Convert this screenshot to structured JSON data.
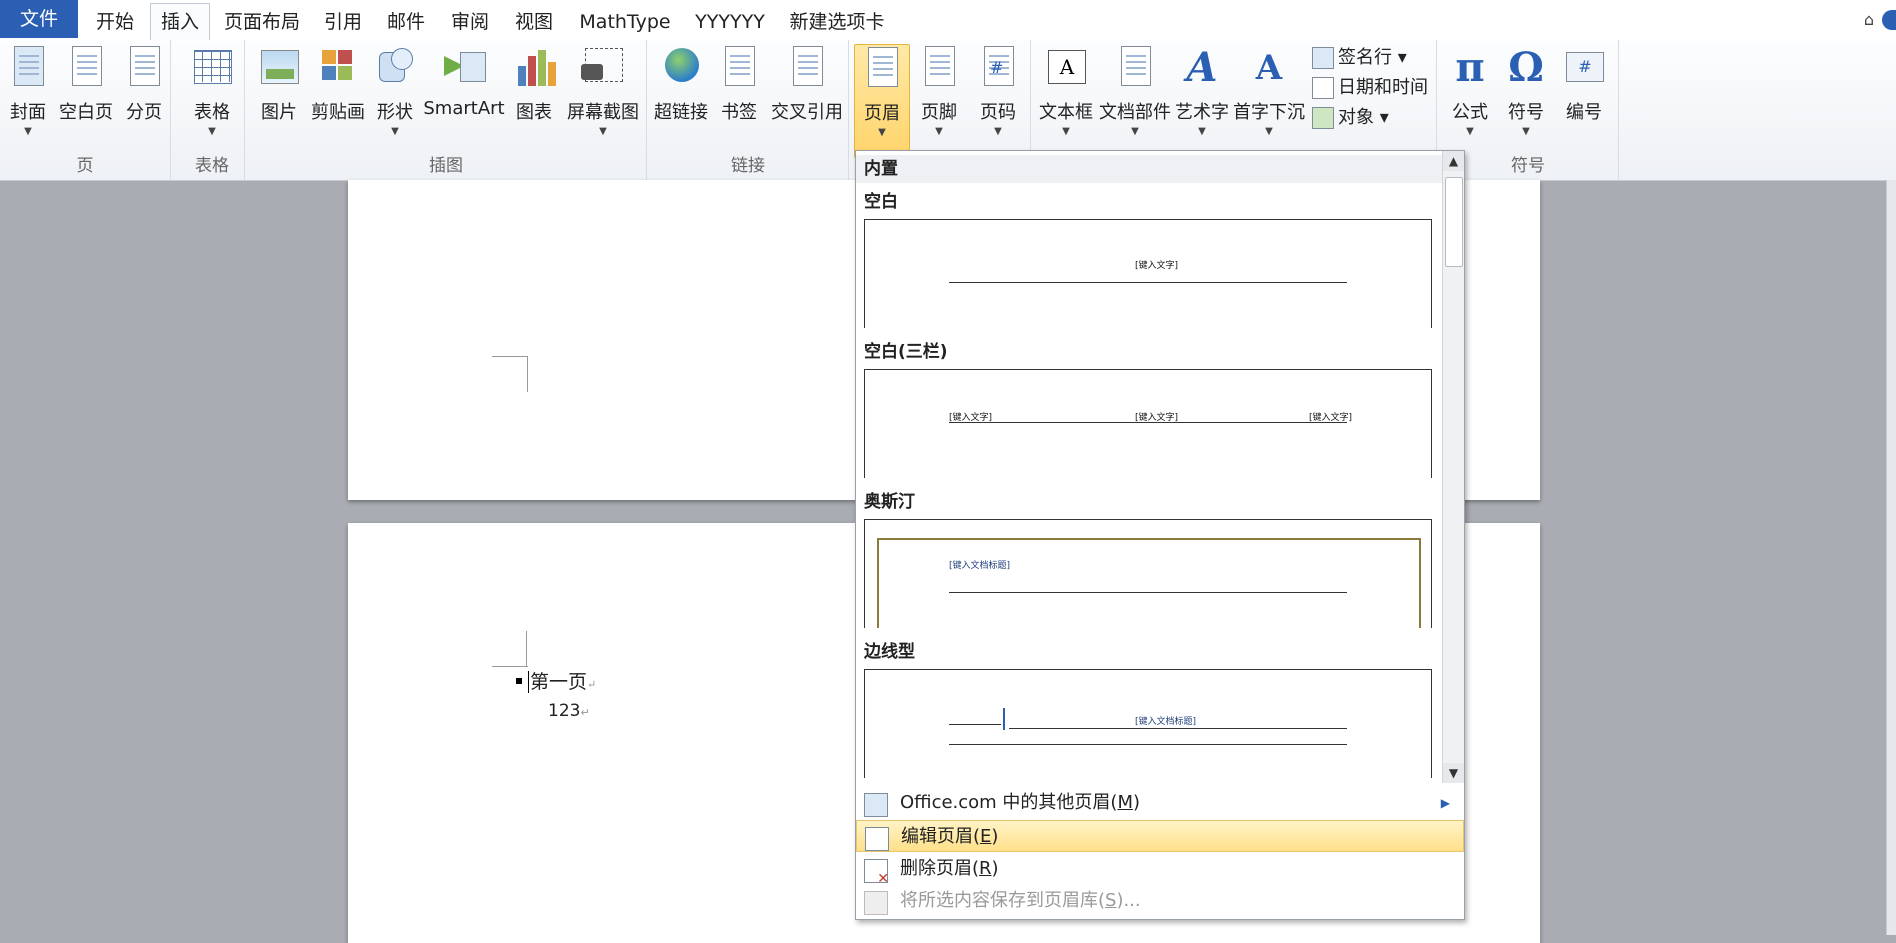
{
  "tabs": [
    {
      "id": "file",
      "label": "文件"
    },
    {
      "id": "home",
      "label": "开始"
    },
    {
      "id": "insert",
      "label": "插入"
    },
    {
      "id": "layout",
      "label": "页面布局"
    },
    {
      "id": "references",
      "label": "引用"
    },
    {
      "id": "mailings",
      "label": "邮件"
    },
    {
      "id": "review",
      "label": "审阅"
    },
    {
      "id": "view",
      "label": "视图"
    },
    {
      "id": "mathtype",
      "label": "MathType"
    },
    {
      "id": "yyyyyy",
      "label": "YYYYYY"
    },
    {
      "id": "newtab",
      "label": "新建选项卡"
    }
  ],
  "ribbon": {
    "groups": {
      "pages": "页",
      "tables": "表格",
      "illustrations": "插图",
      "links": "链接",
      "symbols": "符号"
    },
    "buttons": {
      "cover": "封面",
      "blank_page": "空白页",
      "page_break": "分页",
      "table": "表格",
      "picture": "图片",
      "clip_art": "剪贴画",
      "shapes": "形状",
      "smartart": "SmartArt",
      "chart": "图表",
      "screenshot": "屏幕截图",
      "hyperlink": "超链接",
      "bookmark": "书签",
      "cross_reference": "交叉引用",
      "header": "页眉",
      "footer": "页脚",
      "page_number": "页码",
      "text_box": "文本框",
      "quick_parts": "文档部件",
      "wordart": "艺术字",
      "drop_cap": "首字下沉",
      "signature_line": "签名行",
      "date_time": "日期和时间",
      "object": "对象",
      "equation": "公式",
      "symbol": "符号",
      "number": "编号"
    }
  },
  "document": {
    "line1": "第一页",
    "line2": "123"
  },
  "gallery": {
    "section": "内置",
    "items": [
      {
        "title": "空白",
        "placeholder": "[键入文字]"
      },
      {
        "title": "空白(三栏)",
        "placeholder": "[键入文字]"
      },
      {
        "title": "奥斯汀",
        "placeholder": "[键入文档标题]"
      },
      {
        "title": "边线型",
        "placeholder": "[键入文档标题]"
      }
    ],
    "menu": {
      "more_from_office": "Office.com 中的其他页眉(",
      "more_key": "M",
      "edit_header": "编辑页眉(",
      "edit_key": "E",
      "remove_header": "删除页眉(",
      "remove_key": "R",
      "save_selection": "将所选内容保存到页眉库(",
      "save_key": "S",
      "suffix": ")",
      "save_suffix": ")..."
    }
  },
  "colors": {
    "file_tab": "#2b5fb4",
    "highlight": "#ffd46b",
    "austin_border": "#8c7a3a"
  }
}
